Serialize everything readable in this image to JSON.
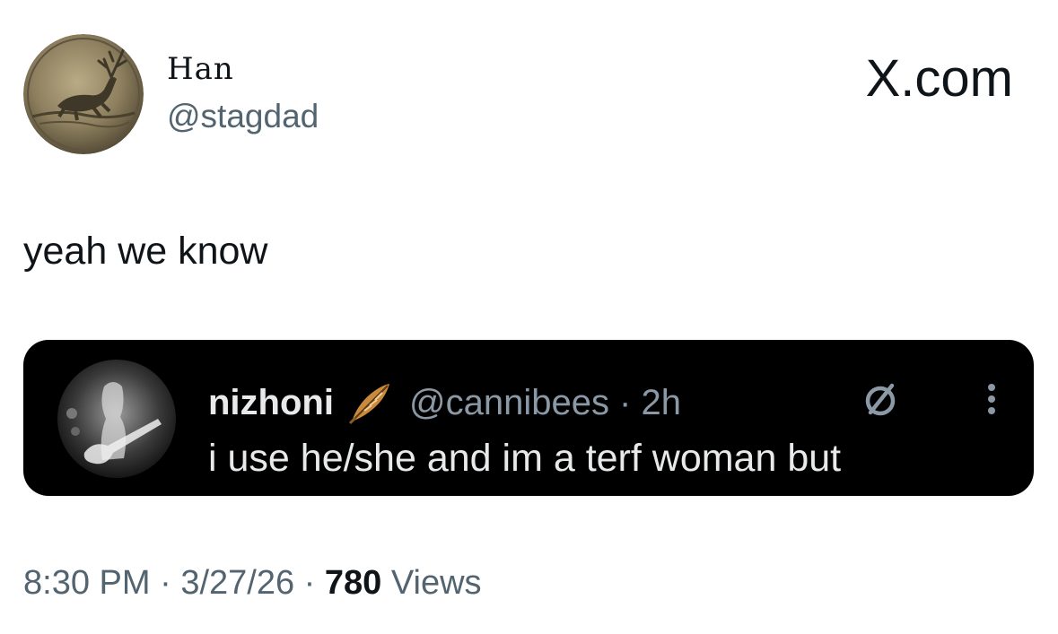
{
  "author": {
    "display_name": "Han",
    "handle": "@stagdad"
  },
  "brand": {
    "label": "X.com"
  },
  "tweet": {
    "text": "yeah we know"
  },
  "quoted_tweet": {
    "display_name": "nizhoni",
    "handle_time": "@cannibees · 2h",
    "text": "i use he/she and im a terf woman but",
    "icons": [
      "feather-icon",
      "grok-icon",
      "more-vertical-icon"
    ]
  },
  "meta": {
    "time": "8:30 PM",
    "separator": "·",
    "date": "3/27/26",
    "views_count": "780",
    "views_label": "Views"
  },
  "colors": {
    "text_primary": "#0f1419",
    "text_secondary": "#536471",
    "quote_bg": "#000000",
    "quote_text": "#e7e9ea",
    "quote_secondary": "#8b98a5"
  }
}
